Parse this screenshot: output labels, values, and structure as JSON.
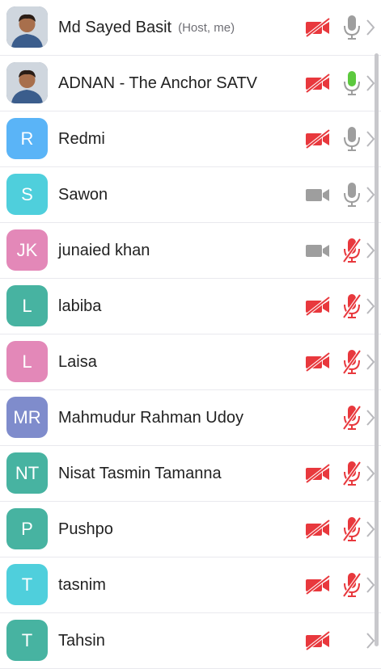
{
  "participants": [
    {
      "name": "Md Sayed Basit",
      "tag": "(Host, me)",
      "initials": "",
      "avatar_color": "",
      "photo": true,
      "cam": "off",
      "mic": "on"
    },
    {
      "name": "ADNAN - The Anchor SATV",
      "tag": "",
      "initials": "",
      "avatar_color": "",
      "photo": true,
      "cam": "off",
      "mic": "speaking"
    },
    {
      "name": "Redmi",
      "tag": "",
      "initials": "R",
      "avatar_color": "#5ab4f7",
      "photo": false,
      "cam": "off",
      "mic": "on"
    },
    {
      "name": "Sawon",
      "tag": "",
      "initials": "S",
      "avatar_color": "#4fcfdc",
      "photo": false,
      "cam": "on",
      "mic": "on"
    },
    {
      "name": "junaied khan",
      "tag": "",
      "initials": "JK",
      "avatar_color": "#e388b8",
      "photo": false,
      "cam": "on",
      "mic": "muted"
    },
    {
      "name": "labiba",
      "tag": "",
      "initials": "L",
      "avatar_color": "#47b3a1",
      "photo": false,
      "cam": "off",
      "mic": "muted"
    },
    {
      "name": "Laisa",
      "tag": "",
      "initials": "L",
      "avatar_color": "#e388b8",
      "photo": false,
      "cam": "off",
      "mic": "muted"
    },
    {
      "name": "Mahmudur Rahman Udoy",
      "tag": "",
      "initials": "MR",
      "avatar_color": "#7f8ccc",
      "photo": false,
      "cam": "none",
      "mic": "muted"
    },
    {
      "name": "Nisat Tasmin Tamanna",
      "tag": "",
      "initials": "NT",
      "avatar_color": "#47b3a1",
      "photo": false,
      "cam": "off",
      "mic": "muted"
    },
    {
      "name": "Pushpo",
      "tag": "",
      "initials": "P",
      "avatar_color": "#47b3a1",
      "photo": false,
      "cam": "off",
      "mic": "muted"
    },
    {
      "name": "tasnim",
      "tag": "",
      "initials": "T",
      "avatar_color": "#4fcfdc",
      "photo": false,
      "cam": "off",
      "mic": "muted"
    },
    {
      "name": "Tahsin",
      "tag": "",
      "initials": "T",
      "avatar_color": "#47b3a1",
      "photo": false,
      "cam": "off",
      "mic": "none"
    }
  ],
  "colors": {
    "muted_red": "#e8383d",
    "icon_gray": "#9e9e9e",
    "speaking_green": "#5cc93e",
    "chevron": "#b8b8bc"
  },
  "icons": {
    "camera_off": "video-off-icon",
    "camera_on": "video-icon",
    "mic_on": "mic-icon",
    "mic_muted": "mic-off-icon",
    "chevron": "chevron-right-icon"
  }
}
